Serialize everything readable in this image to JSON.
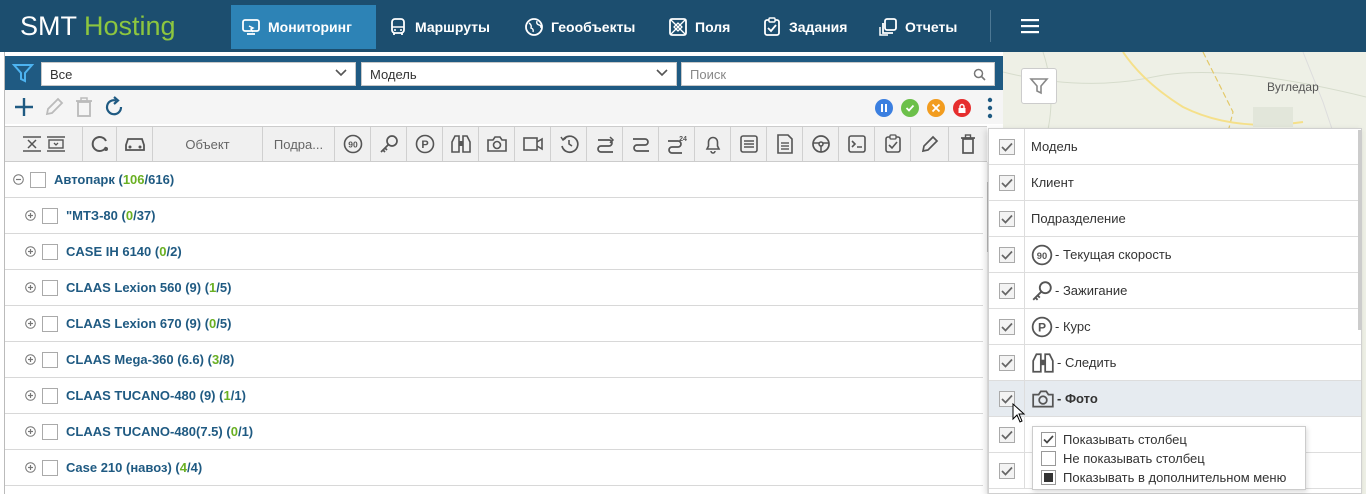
{
  "app": {
    "logo_part1": "SMT",
    "logo_part2": "Hosting"
  },
  "nav": {
    "items": [
      {
        "label": "Мониторинг",
        "icon": "monitor-icon",
        "active": true
      },
      {
        "label": "Маршруты",
        "icon": "bus-icon"
      },
      {
        "label": "Геообъекты",
        "icon": "globe-icon"
      },
      {
        "label": "Поля",
        "icon": "field-icon"
      },
      {
        "label": "Задания",
        "icon": "task-icon"
      },
      {
        "label": "Отчеты",
        "icon": "reports-icon"
      }
    ],
    "menu_icon": "hamburger-icon"
  },
  "filters": {
    "group_value": "Все",
    "model_value": "Модель",
    "search_placeholder": "Поиск"
  },
  "columns": {
    "object_label": "Объект",
    "division_label": "Подра..."
  },
  "tree": {
    "root": {
      "name": "Автопарк",
      "online": "106",
      "total": "616"
    },
    "groups": [
      {
        "name": "\"МТЗ-80",
        "online": "0",
        "total": "37"
      },
      {
        "name": "CASE IH 6140",
        "online": "0",
        "total": "2"
      },
      {
        "name": "CLAAS Lexion 560 (9)",
        "online": "1",
        "total": "5"
      },
      {
        "name": "CLAAS Lexion 670 (9)",
        "online": "0",
        "total": "5"
      },
      {
        "name": "CLAAS Mega-360 (6.6)",
        "online": "3",
        "total": "8"
      },
      {
        "name": "CLAAS TUCANO-480 (9)",
        "online": "1",
        "total": "1"
      },
      {
        "name": "CLAAS TUCANO-480(7.5)",
        "online": "0",
        "total": "1"
      },
      {
        "name": "Case 210 (навоз)",
        "online": "4",
        "total": "4"
      }
    ]
  },
  "map": {
    "place_label": "Вугледар"
  },
  "column_menu": {
    "items": [
      {
        "label": "Модель"
      },
      {
        "label": "Клиент"
      },
      {
        "label": "Подразделение"
      },
      {
        "label": "- Текущая скорость",
        "icon": "speed-icon"
      },
      {
        "label": "- Зажигание",
        "icon": "key-icon"
      },
      {
        "label": "- Курс",
        "icon": "parking-icon"
      },
      {
        "label": "- Следить",
        "icon": "binoculars-icon"
      },
      {
        "label": "- Фото",
        "icon": "camera-icon",
        "highlighted": true
      }
    ],
    "submenu": [
      {
        "label": "Показывать столбец",
        "state": "checked"
      },
      {
        "label": "Не показывать столбец",
        "state": "empty"
      },
      {
        "label": "Показывать в дополнительном меню",
        "state": "filled"
      }
    ]
  },
  "colors": {
    "nav_bg": "#1c4e6f",
    "nav_active": "#2d83b6",
    "logo_green": "#8dc63f",
    "count_green": "#6ab023",
    "link_blue": "#1f5a82"
  }
}
